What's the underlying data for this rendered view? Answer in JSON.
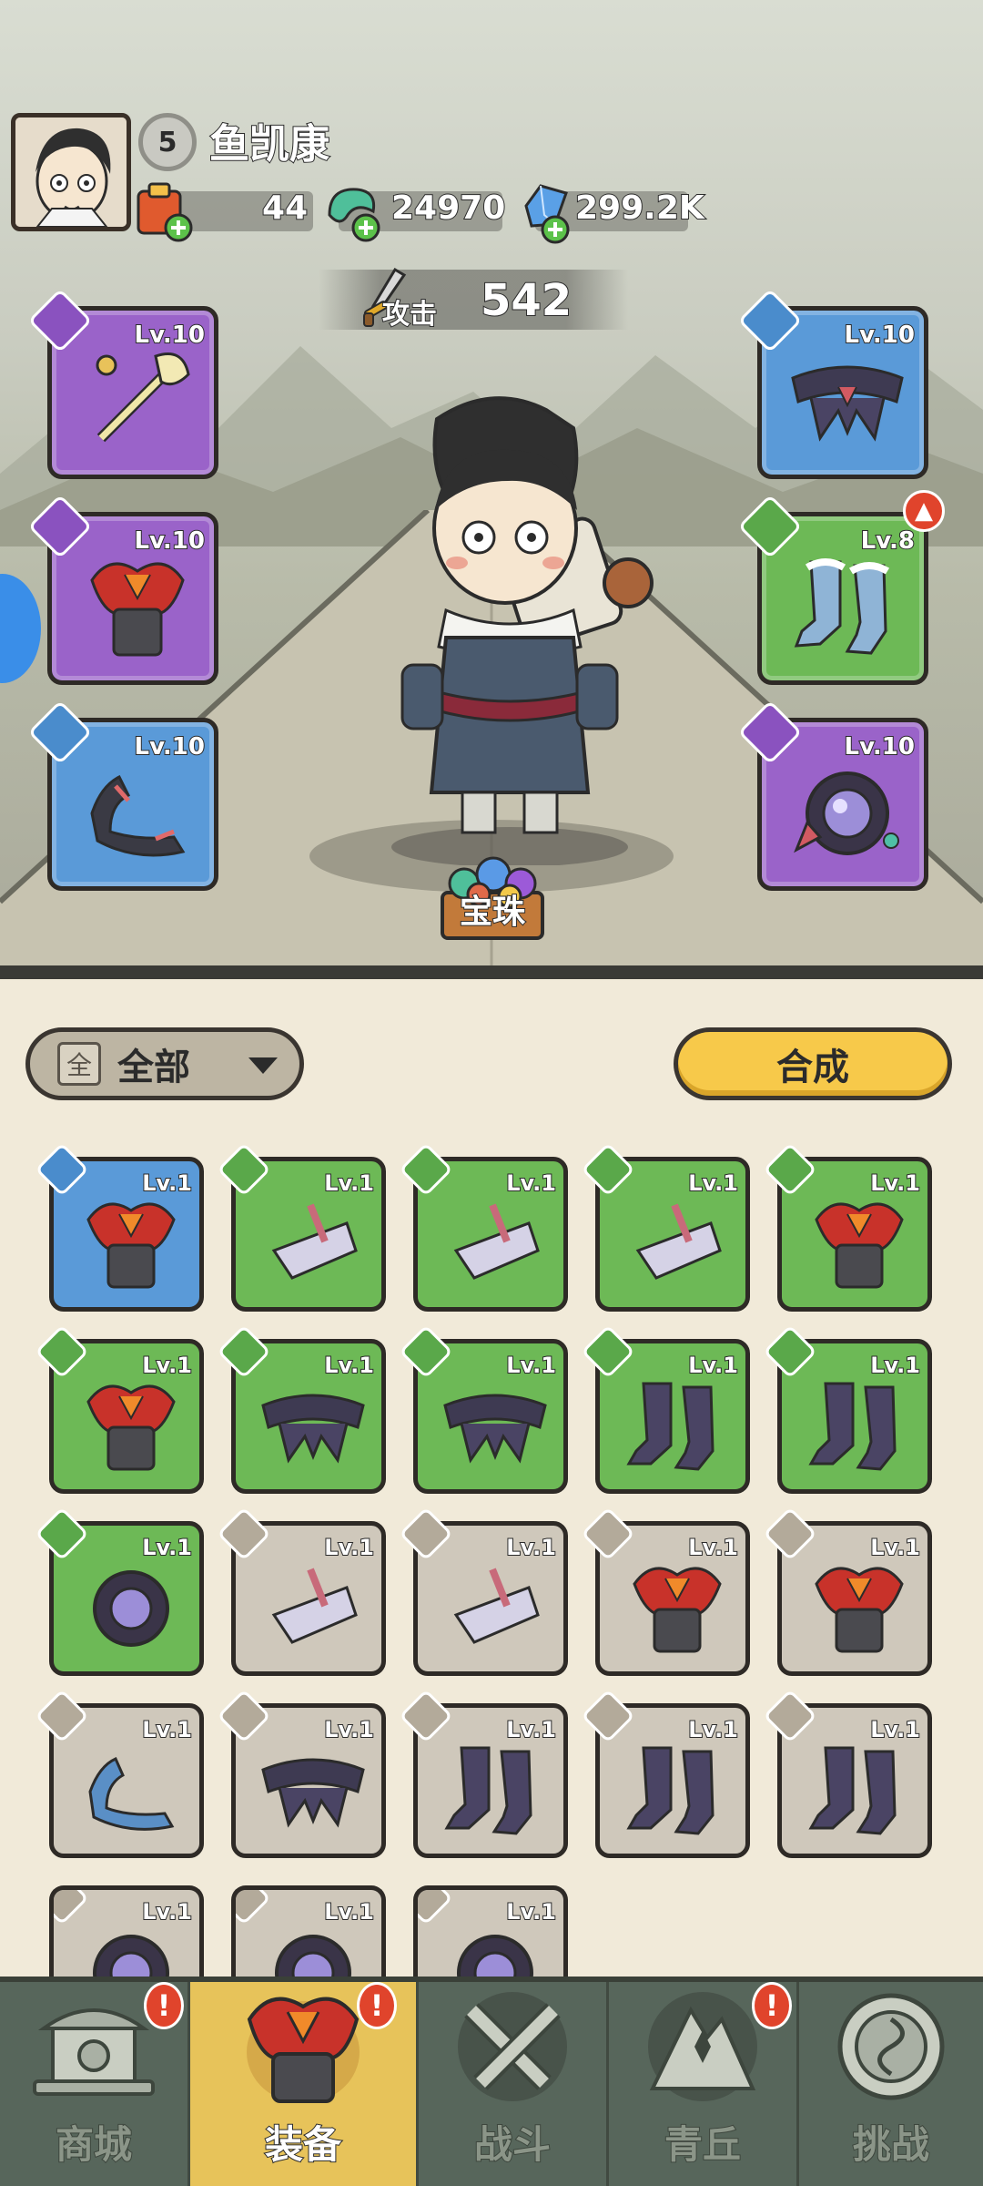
{
  "player": {
    "level": "5",
    "name": "鱼凯康"
  },
  "resources": [
    {
      "name": "scroll",
      "value": "44"
    },
    {
      "name": "jade",
      "value": "24970"
    },
    {
      "name": "crystal",
      "value": "299.2K"
    }
  ],
  "attack": {
    "label": "攻击",
    "value": "542"
  },
  "equipped": {
    "left": [
      {
        "slot": "weapon",
        "level": "Lv.10",
        "rarity": "purple"
      },
      {
        "slot": "armor",
        "level": "Lv.10",
        "rarity": "purple"
      },
      {
        "slot": "necklace",
        "level": "Lv.10",
        "rarity": "blue"
      }
    ],
    "right": [
      {
        "slot": "belt",
        "level": "Lv.10",
        "rarity": "blue"
      },
      {
        "slot": "boots",
        "level": "Lv.8",
        "rarity": "green",
        "upgradable": true
      },
      {
        "slot": "ring",
        "level": "Lv.10",
        "rarity": "purple"
      }
    ]
  },
  "treasure_label": "宝珠",
  "filter": {
    "label": "全部",
    "icon_text": "全"
  },
  "combine_label": "合成",
  "inventory": [
    {
      "type": "armor",
      "level": "Lv.1",
      "rarity": "blue"
    },
    {
      "type": "weapon",
      "level": "Lv.1",
      "rarity": "green"
    },
    {
      "type": "weapon",
      "level": "Lv.1",
      "rarity": "green"
    },
    {
      "type": "weapon",
      "level": "Lv.1",
      "rarity": "green"
    },
    {
      "type": "armor",
      "level": "Lv.1",
      "rarity": "green"
    },
    {
      "type": "armor",
      "level": "Lv.1",
      "rarity": "green"
    },
    {
      "type": "belt",
      "level": "Lv.1",
      "rarity": "green"
    },
    {
      "type": "belt",
      "level": "Lv.1",
      "rarity": "green"
    },
    {
      "type": "boots",
      "level": "Lv.1",
      "rarity": "green"
    },
    {
      "type": "boots",
      "level": "Lv.1",
      "rarity": "green"
    },
    {
      "type": "ring",
      "level": "Lv.1",
      "rarity": "green"
    },
    {
      "type": "weapon",
      "level": "Lv.1",
      "rarity": "gray"
    },
    {
      "type": "weapon",
      "level": "Lv.1",
      "rarity": "gray"
    },
    {
      "type": "armor",
      "level": "Lv.1",
      "rarity": "gray"
    },
    {
      "type": "armor",
      "level": "Lv.1",
      "rarity": "gray"
    },
    {
      "type": "necklace",
      "level": "Lv.1",
      "rarity": "gray"
    },
    {
      "type": "belt",
      "level": "Lv.1",
      "rarity": "gray"
    },
    {
      "type": "boots",
      "level": "Lv.1",
      "rarity": "gray"
    },
    {
      "type": "boots",
      "level": "Lv.1",
      "rarity": "gray"
    },
    {
      "type": "boots",
      "level": "Lv.1",
      "rarity": "gray"
    },
    {
      "type": "ring",
      "level": "Lv.1",
      "rarity": "gray"
    },
    {
      "type": "ring",
      "level": "Lv.1",
      "rarity": "gray"
    },
    {
      "type": "ring",
      "level": "Lv.1",
      "rarity": "gray"
    }
  ],
  "nav": [
    {
      "label": "商城",
      "icon": "shop-icon",
      "alert": true
    },
    {
      "label": "装备",
      "icon": "equipment-icon",
      "alert": true,
      "active": true
    },
    {
      "label": "战斗",
      "icon": "battle-icon",
      "alert": false
    },
    {
      "label": "青丘",
      "icon": "mountain-icon",
      "alert": true
    },
    {
      "label": "挑战",
      "icon": "challenge-icon",
      "alert": false
    }
  ],
  "colors": {
    "purple": "#9a63c9",
    "blue": "#5a9ad8",
    "green": "#6db956",
    "gray": "#cfc8bb",
    "combine": "#f7c94a",
    "nav_bg": "#57665b",
    "nav_active": "#e7c35a"
  }
}
